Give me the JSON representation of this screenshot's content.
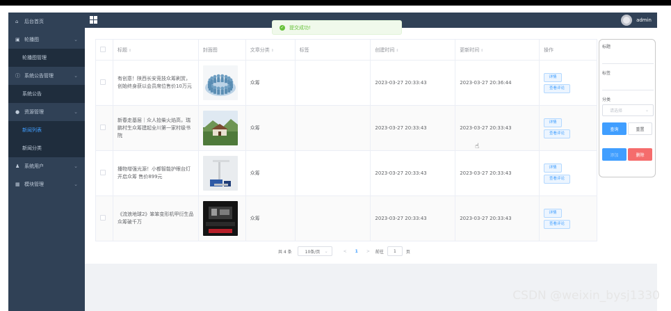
{
  "app": {
    "title": "",
    "user": "admin"
  },
  "toast": {
    "message": "提交成功!"
  },
  "sidebar": {
    "items": [
      {
        "icon": "home-icon",
        "label": "后台首页",
        "type": "item"
      },
      {
        "icon": "image-icon",
        "label": "轮播图",
        "type": "group"
      },
      {
        "label": "轮播图管理",
        "type": "sub"
      },
      {
        "icon": "info-icon",
        "label": "系统公告管理",
        "type": "group"
      },
      {
        "label": "系统公告",
        "type": "sub"
      },
      {
        "icon": "pin-icon",
        "label": "资源管理",
        "type": "group"
      },
      {
        "label": "新闻列表",
        "type": "sub",
        "active": true
      },
      {
        "label": "新闻分类",
        "type": "sub"
      },
      {
        "icon": "user-icon",
        "label": "系统用户",
        "type": "group"
      },
      {
        "icon": "grid-icon",
        "label": "模块管理",
        "type": "group"
      }
    ]
  },
  "table": {
    "headers": [
      "标题",
      "封面图",
      "文章分类",
      "标签",
      "创建时间",
      "更新时间",
      "操作"
    ],
    "rows": [
      {
        "title": "有创意！陕西长安竞技众筹刷赏，创始终身获以会员席位售价10万元",
        "cover": "people-crowd",
        "category": "众筹",
        "tags": "",
        "created": "2023-03-27 20:33:43",
        "updated": "2023-03-27 20:36:44"
      },
      {
        "title": "新春走基层｜众人拾柴火焰高，瑞鹏村生众筹建起全川第一家村级书院",
        "cover": "village-building",
        "category": "众筹",
        "tags": "",
        "created": "2023-03-27 20:33:43",
        "updated": "2023-03-27 20:33:43"
      },
      {
        "title": "播物增强光源！小都智能护眼台灯开启众筹 售价899元",
        "cover": "desk-lamp",
        "category": "众筹",
        "tags": "",
        "created": "2023-03-27 20:33:43",
        "updated": "2023-03-27 20:33:43"
      },
      {
        "title": "《流浪地球2》笨笨变形机甲衍生品众筹破千万",
        "cover": "mech-toy",
        "category": "众筹",
        "tags": "",
        "created": "2023-03-27 20:33:43",
        "updated": "2023-03-27 20:33:43"
      }
    ],
    "row_actions": {
      "detail": "详情",
      "comments": "查看评论"
    }
  },
  "pagination": {
    "total": "共 4 条",
    "page_size": "10条/页",
    "current": "1",
    "goto_label": "前往",
    "goto_value": "1",
    "page_suffix": "页",
    "prev": "<",
    "next": ">"
  },
  "search_panel": {
    "title_label": "标题",
    "tags_label": "标签",
    "category_label": "分类",
    "category_placeholder": "请选择",
    "query_button": "查询",
    "reset_button": "重置",
    "add_button": "添加",
    "delete_button": "删除"
  },
  "watermark": "CSDN @weixin_bysj1330",
  "colors": {
    "sidebar": "#304156",
    "accent": "#409eff",
    "danger": "#f56c6c",
    "success": "#67c23a"
  }
}
